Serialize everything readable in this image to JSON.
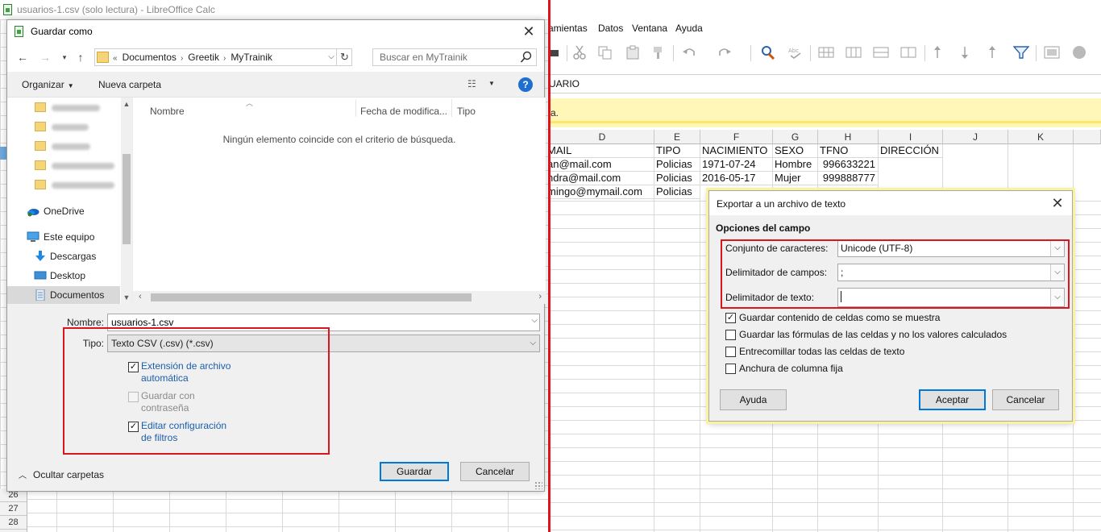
{
  "window": {
    "title": "usuarios-1.csv (solo lectura) - LibreOffice Calc"
  },
  "menu": {
    "items": [
      "amientas",
      "Datos",
      "Ventana",
      "Ayuda"
    ]
  },
  "formula_bar": {
    "value": "UARIO"
  },
  "info_bar": {
    "text": "ra."
  },
  "sheet": {
    "columns": [
      "D",
      "E",
      "F",
      "G",
      "H",
      "I",
      "J",
      "K"
    ],
    "header_row": [
      "MAIL",
      "TIPO",
      "NACIMIENTO",
      "SEXO",
      "TFNO",
      "DIRECCIÓN"
    ],
    "rows": [
      [
        "an@mail.com",
        "Policias",
        "1971-07-24",
        "Hombre",
        "996633221"
      ],
      [
        "ndra@mail.com",
        "Policias",
        "2016-05-17",
        "Mujer",
        "999888777"
      ],
      [
        "mingo@mymail.com",
        "Policias",
        "",
        "",
        ""
      ]
    ],
    "row_numbers": [
      "26",
      "27",
      "28"
    ]
  },
  "save_dialog": {
    "title": "Guardar como",
    "breadcrumb": [
      "Documentos",
      "Greetik",
      "MyTrainik"
    ],
    "search_placeholder": "Buscar en MyTrainik",
    "organize": "Organizar",
    "new_folder": "Nueva carpeta",
    "nav_items": {
      "onedrive": "OneDrive",
      "this_pc": "Este equipo",
      "downloads": "Descargas",
      "desktop": "Desktop",
      "documents": "Documentos"
    },
    "columns": {
      "name": "Nombre",
      "modified": "Fecha de modifica...",
      "type": "Tipo"
    },
    "empty_message": "Ningún elemento coincide con el criterio de búsqueda.",
    "filename_label": "Nombre:",
    "filename_value": "usuarios-1.csv",
    "filetype_label": "Tipo:",
    "filetype_value": "Texto CSV (.csv) (*.csv)",
    "options": {
      "auto_ext": {
        "label_1": "Extensión de archivo",
        "label_2": "automática",
        "checked": true
      },
      "password": {
        "label_1": "Guardar con",
        "label_2": "contraseña",
        "checked": false,
        "disabled": true
      },
      "filter": {
        "label_1": "Editar configuración",
        "label_2": "de filtros",
        "checked": true
      }
    },
    "hide_folders": "Ocultar carpetas",
    "save_button": "Guardar",
    "cancel_button": "Cancelar"
  },
  "export_dialog": {
    "title": "Exportar a un archivo de texto",
    "section": "Opciones del campo",
    "charset_label": "Conjunto de caracteres:",
    "charset_value": "Unicode (UTF-8)",
    "field_delim_label": "Delimitador de campos:",
    "field_delim_value": ";",
    "text_delim_label": "Delimitador de texto:",
    "text_delim_value": "",
    "options": [
      {
        "label": "Guardar contenido de celdas como se muestra",
        "checked": true
      },
      {
        "label": "Guardar las fórmulas de las celdas y no los valores calculados",
        "checked": false
      },
      {
        "label": "Entrecomillar todas las celdas de texto",
        "checked": false
      },
      {
        "label": "Anchura de columna fija",
        "checked": false
      }
    ],
    "help_button": "Ayuda",
    "ok_button": "Aceptar",
    "cancel_button": "Cancelar"
  },
  "colors": {
    "highlight_red": "#d9161e",
    "link_blue": "#1b5eab",
    "focus_blue": "#0078d7",
    "infobar_yellow": "#fff7b8"
  }
}
